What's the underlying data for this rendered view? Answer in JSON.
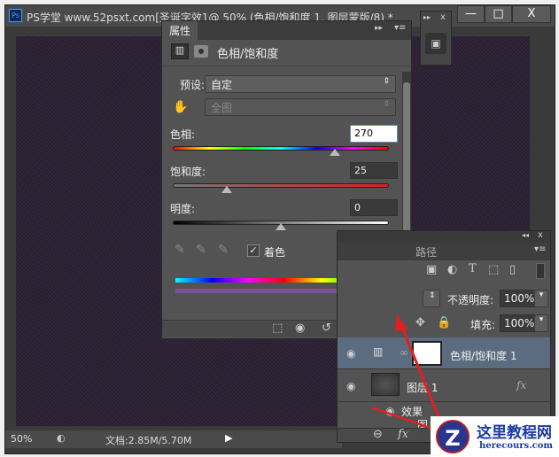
{
  "window": {
    "title": "PS学堂 www.52psxt.com[圣诞字效1@ 50% (色相/饱和度 1, 图层蒙版/8) *",
    "app_icon": "Ps",
    "minimize": "—",
    "maximize": "□",
    "close": "X"
  },
  "mini_panel": {
    "expand": "▸▸",
    "close": "x"
  },
  "status": {
    "zoom": "50%",
    "doc": "文档:2.85M/5.70M"
  },
  "properties": {
    "tab": "属性",
    "adjustment_title": "色相/饱和度",
    "preset_label": "预设:",
    "preset_value": "自定",
    "channel_value": "全图",
    "hue_label": "色相:",
    "hue_value": "270",
    "hue_fraction": 0.75,
    "saturation_label": "饱和度:",
    "saturation_value": "25",
    "saturation_fraction": 0.25,
    "lightness_label": "明度:",
    "lightness_value": "0",
    "lightness_fraction": 0.5,
    "colorize_label": "着色",
    "colorize_checked": true
  },
  "layers": {
    "tab_partial": "路径",
    "opacity_label": "不透明度:",
    "opacity_value": "100%",
    "fill_label": "填充:",
    "fill_value": "100%",
    "items": [
      {
        "name": "色相/饱和度 1"
      },
      {
        "name": "图层 1",
        "fx": "fx"
      }
    ],
    "effects_label": "效果",
    "partial_sub": "图"
  },
  "watermark": {
    "title": "这里教程网",
    "url": "herecours.com"
  }
}
